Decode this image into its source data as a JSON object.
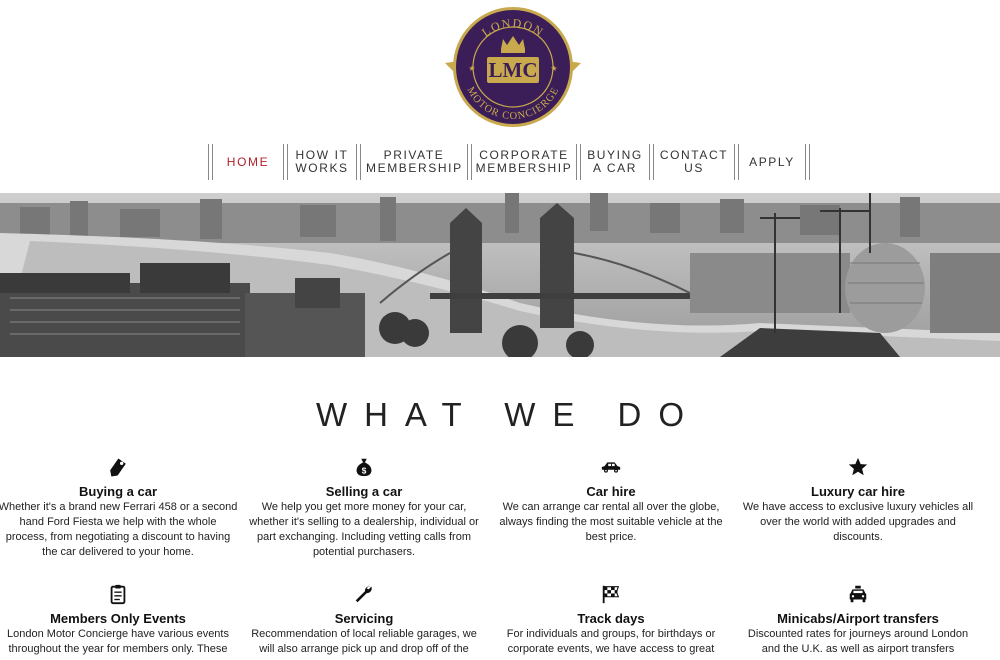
{
  "logo": {
    "top_text": "LONDON",
    "monogram": "LMC",
    "bottom_text": "MOTOR CONCIERGE"
  },
  "nav": {
    "items": [
      {
        "label": "HOME",
        "active": true
      },
      {
        "label": "HOW IT WORKS"
      },
      {
        "label": "PRIVATE MEMBERSHIP"
      },
      {
        "label": "CORPORATE MEMBERSHIP"
      },
      {
        "label": "BUYING A CAR"
      },
      {
        "label": "CONTACT US"
      },
      {
        "label": "APPLY"
      }
    ]
  },
  "colors": {
    "accent": "#b3202a",
    "logo_purple": "#3b1e57",
    "logo_gold": "#c9a94d"
  },
  "section": {
    "title": "WHAT WE DO"
  },
  "features": [
    {
      "icon": "price-tag-icon",
      "title": "Buying a car",
      "text": "Whether it's a brand new Ferrari 458 or a second hand Ford Fiesta we help with the whole process, from negotiating a discount to having the car delivered to your home."
    },
    {
      "icon": "money-bag-icon",
      "title": "Selling a car",
      "text": "We help you get more money for your car, whether it's selling to a dealership, individual or part exchanging. Including vetting calls from potential purchasers."
    },
    {
      "icon": "car-icon",
      "title": "Car hire",
      "text": "We can arrange car rental all over the globe, always finding the most suitable vehicle at the best price."
    },
    {
      "icon": "star-icon",
      "title": "Luxury car hire",
      "text": "We have access to exclusive luxury vehicles all over the world with added upgrades and discounts."
    },
    {
      "icon": "clipboard-icon",
      "title": "Members Only Events",
      "text": "London Motor Concierge have various events throughout the year for members only. These"
    },
    {
      "icon": "wrench-icon",
      "title": "Servicing",
      "text": "Recommendation of local reliable garages, we will also arrange pick up and drop off of the"
    },
    {
      "icon": "checkered-flag-icon",
      "title": "Track days",
      "text": "For individuals and groups, for birthdays or corporate events, we have access to great"
    },
    {
      "icon": "taxi-icon",
      "title": "Minicabs/Airport transfers",
      "text": "Discounted rates for journeys around London and the U.K. as well as airport transfers"
    }
  ]
}
